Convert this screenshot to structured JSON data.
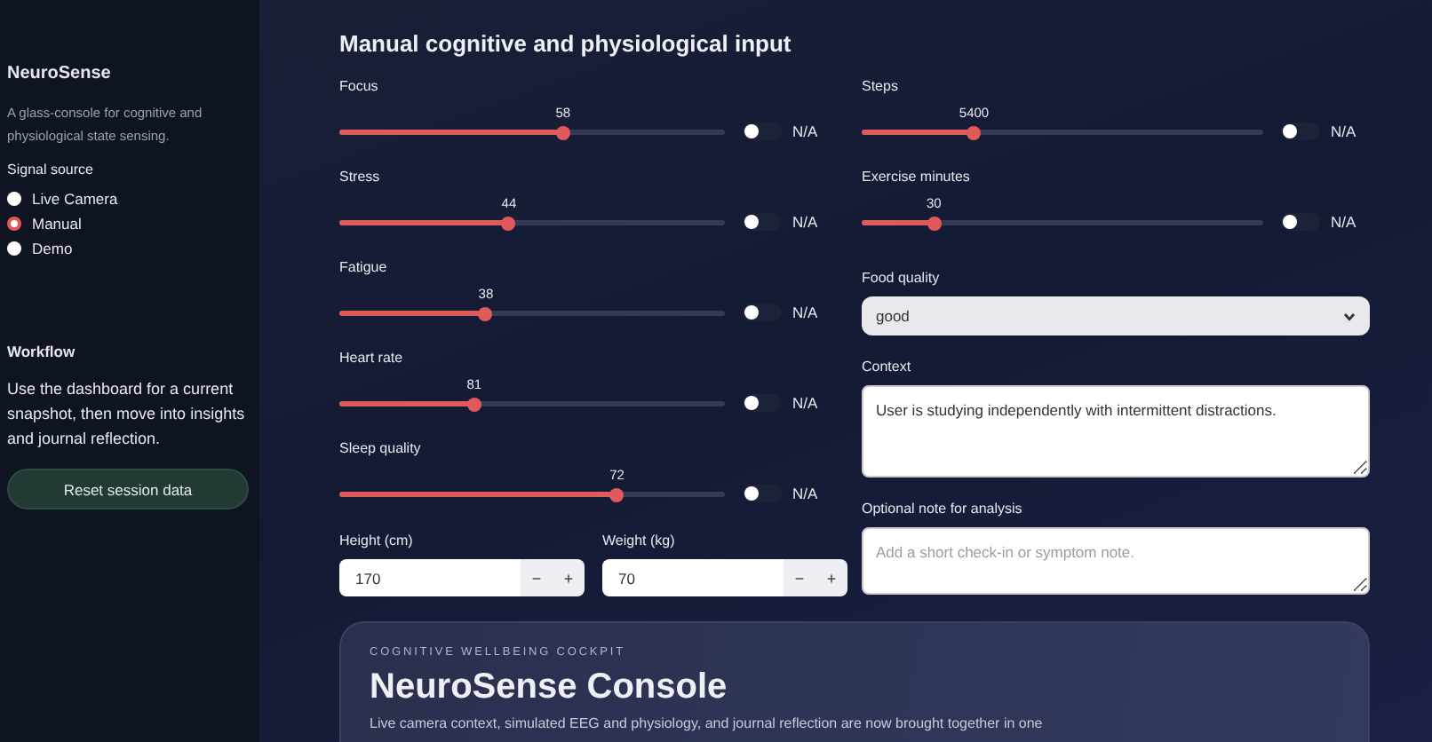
{
  "sidebar": {
    "title": "NeuroSense",
    "description": "A glass-console for cognitive and physiological state sensing.",
    "signal_source": {
      "label": "Signal source",
      "options": [
        {
          "label": "Live Camera",
          "selected": false
        },
        {
          "label": "Manual",
          "selected": true
        },
        {
          "label": "Demo",
          "selected": false
        }
      ]
    },
    "workflow": {
      "title": "Workflow",
      "text": "Use the dashboard for a current snapshot, then move into insights and journal reflection."
    },
    "reset_button": "Reset session data"
  },
  "heading": "Manual cognitive and physiological input",
  "left_sliders": [
    {
      "label": "Focus",
      "value": "58",
      "level": 0.58,
      "toggle_label": "N/A",
      "on": false
    },
    {
      "label": "Stress",
      "value": "44",
      "level": 0.44,
      "toggle_label": "N/A",
      "on": false
    },
    {
      "label": "Fatigue",
      "value": "38",
      "level": 0.38,
      "toggle_label": "N/A",
      "on": false
    },
    {
      "label": "Heart rate",
      "value": "81",
      "level": 0.35,
      "toggle_label": "N/A",
      "on": false
    },
    {
      "label": "Sleep quality",
      "value": "72",
      "level": 0.72,
      "toggle_label": "N/A",
      "on": false
    }
  ],
  "number_inputs": [
    {
      "label": "Height (cm)",
      "value": "170",
      "minus": "−",
      "plus": "+"
    },
    {
      "label": "Weight (kg)",
      "value": "70",
      "minus": "−",
      "plus": "+"
    }
  ],
  "right_sliders": [
    {
      "label": "Steps",
      "value": "5400",
      "level": 0.28,
      "toggle_label": "N/A",
      "on": false
    },
    {
      "label": "Exercise minutes",
      "value": "30",
      "level": 0.18,
      "toggle_label": "N/A",
      "on": false
    }
  ],
  "food_quality": {
    "label": "Food quality",
    "value": "good"
  },
  "context": {
    "label": "Context",
    "value": "User is studying independently with intermittent distractions."
  },
  "note": {
    "label": "Optional note for analysis",
    "placeholder": "Add a short check-in or symptom note."
  },
  "hero": {
    "eyebrow": "COGNITIVE WELLBEING COCKPIT",
    "title": "NeuroSense Console",
    "subtitle": "Live camera context, simulated EEG and physiology, and journal reflection are now brought together in one"
  }
}
